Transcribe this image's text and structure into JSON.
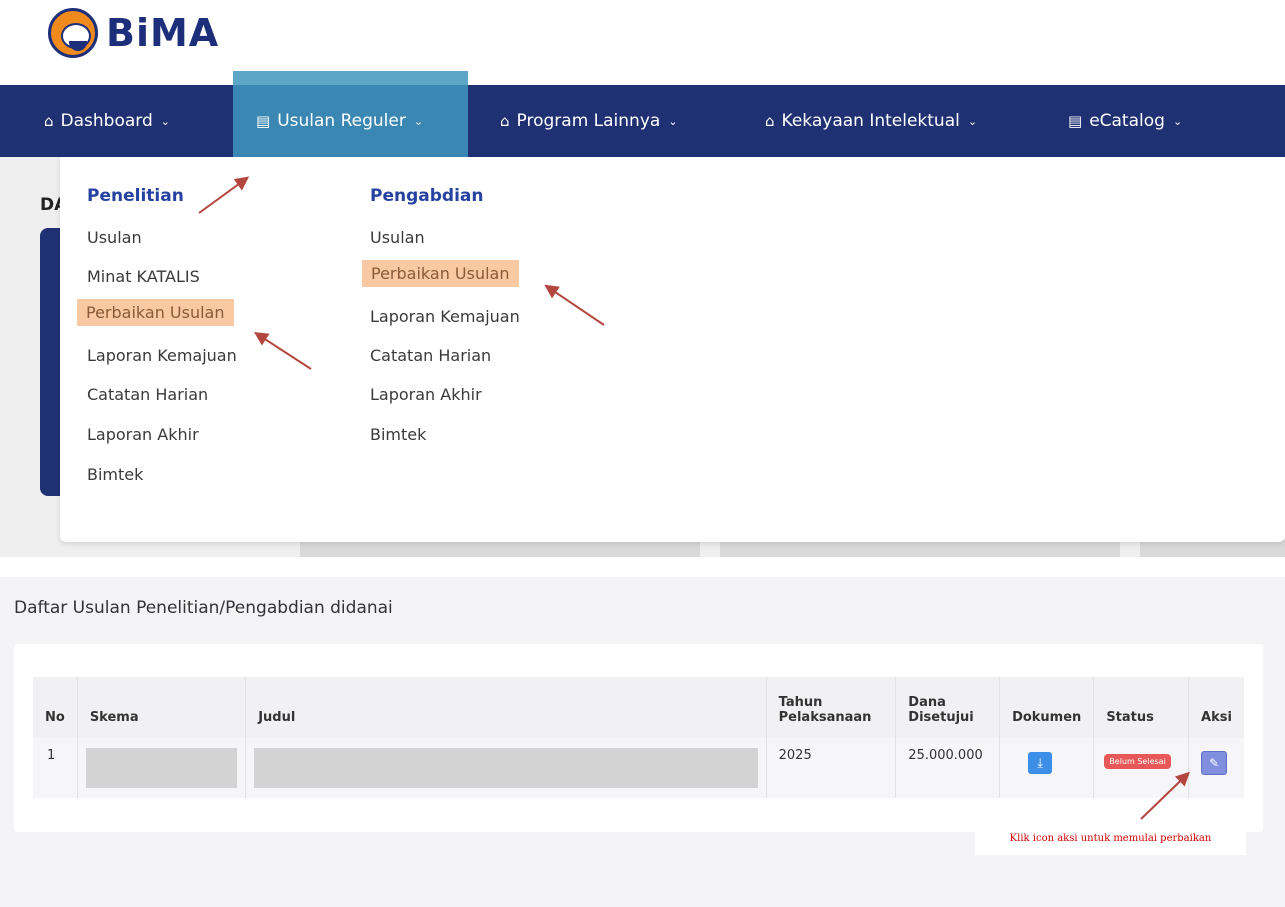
{
  "logo": {
    "text": "BiMA",
    "icon": "bima-mascot-icon",
    "colors": {
      "navy": "#1d2f7a",
      "orange": "#f08a1c"
    }
  },
  "nav": {
    "items": [
      {
        "icon": "home-icon",
        "label": "Dashboard"
      },
      {
        "icon": "document-icon",
        "label": "Usulan Reguler"
      },
      {
        "icon": "home-icon",
        "label": "Program Lainnya"
      },
      {
        "icon": "home-icon",
        "label": "Kekayaan Intelektual"
      },
      {
        "icon": "document-icon",
        "label": "eCatalog"
      }
    ],
    "active_index": 1,
    "color": "#1f3172"
  },
  "background": {
    "heading": "DA"
  },
  "dropdown": {
    "penelitian": {
      "title": "Penelitian",
      "items": [
        "Usulan",
        "Minat KATALIS",
        "Perbaikan Usulan",
        "Laporan Kemajuan",
        "Catatan Harian",
        "Laporan Akhir",
        "Bimtek"
      ]
    },
    "pengabdian": {
      "title": "Pengabdian",
      "items": [
        "Usulan",
        "Perbaikan Usulan",
        "Laporan Kemajuan",
        "Catatan Harian",
        "Laporan Akhir",
        "Bimtek"
      ]
    },
    "highlight_color": "#f9c9a3"
  },
  "section": {
    "title": "Daftar Usulan Penelitian/Pengabdian didanai",
    "table": {
      "headers": {
        "no": "No",
        "skema": "Skema",
        "judul": "Judul",
        "tahun": "Tahun Pelaksanaan",
        "dana": "Dana Disetujui",
        "dokumen": "Dokumen",
        "status": "Status",
        "aksi": "Aksi"
      },
      "rows": [
        {
          "no": "1",
          "tahun": "2025",
          "dana": "25.000.000",
          "status": "Belum Selesai",
          "dokumen_icon": "download-icon",
          "aksi_icon": "edit-icon"
        }
      ]
    }
  },
  "annotation": {
    "note": "Klik icon aksi untuk memulai perbaikan",
    "arrow_color": "#b3463e"
  }
}
